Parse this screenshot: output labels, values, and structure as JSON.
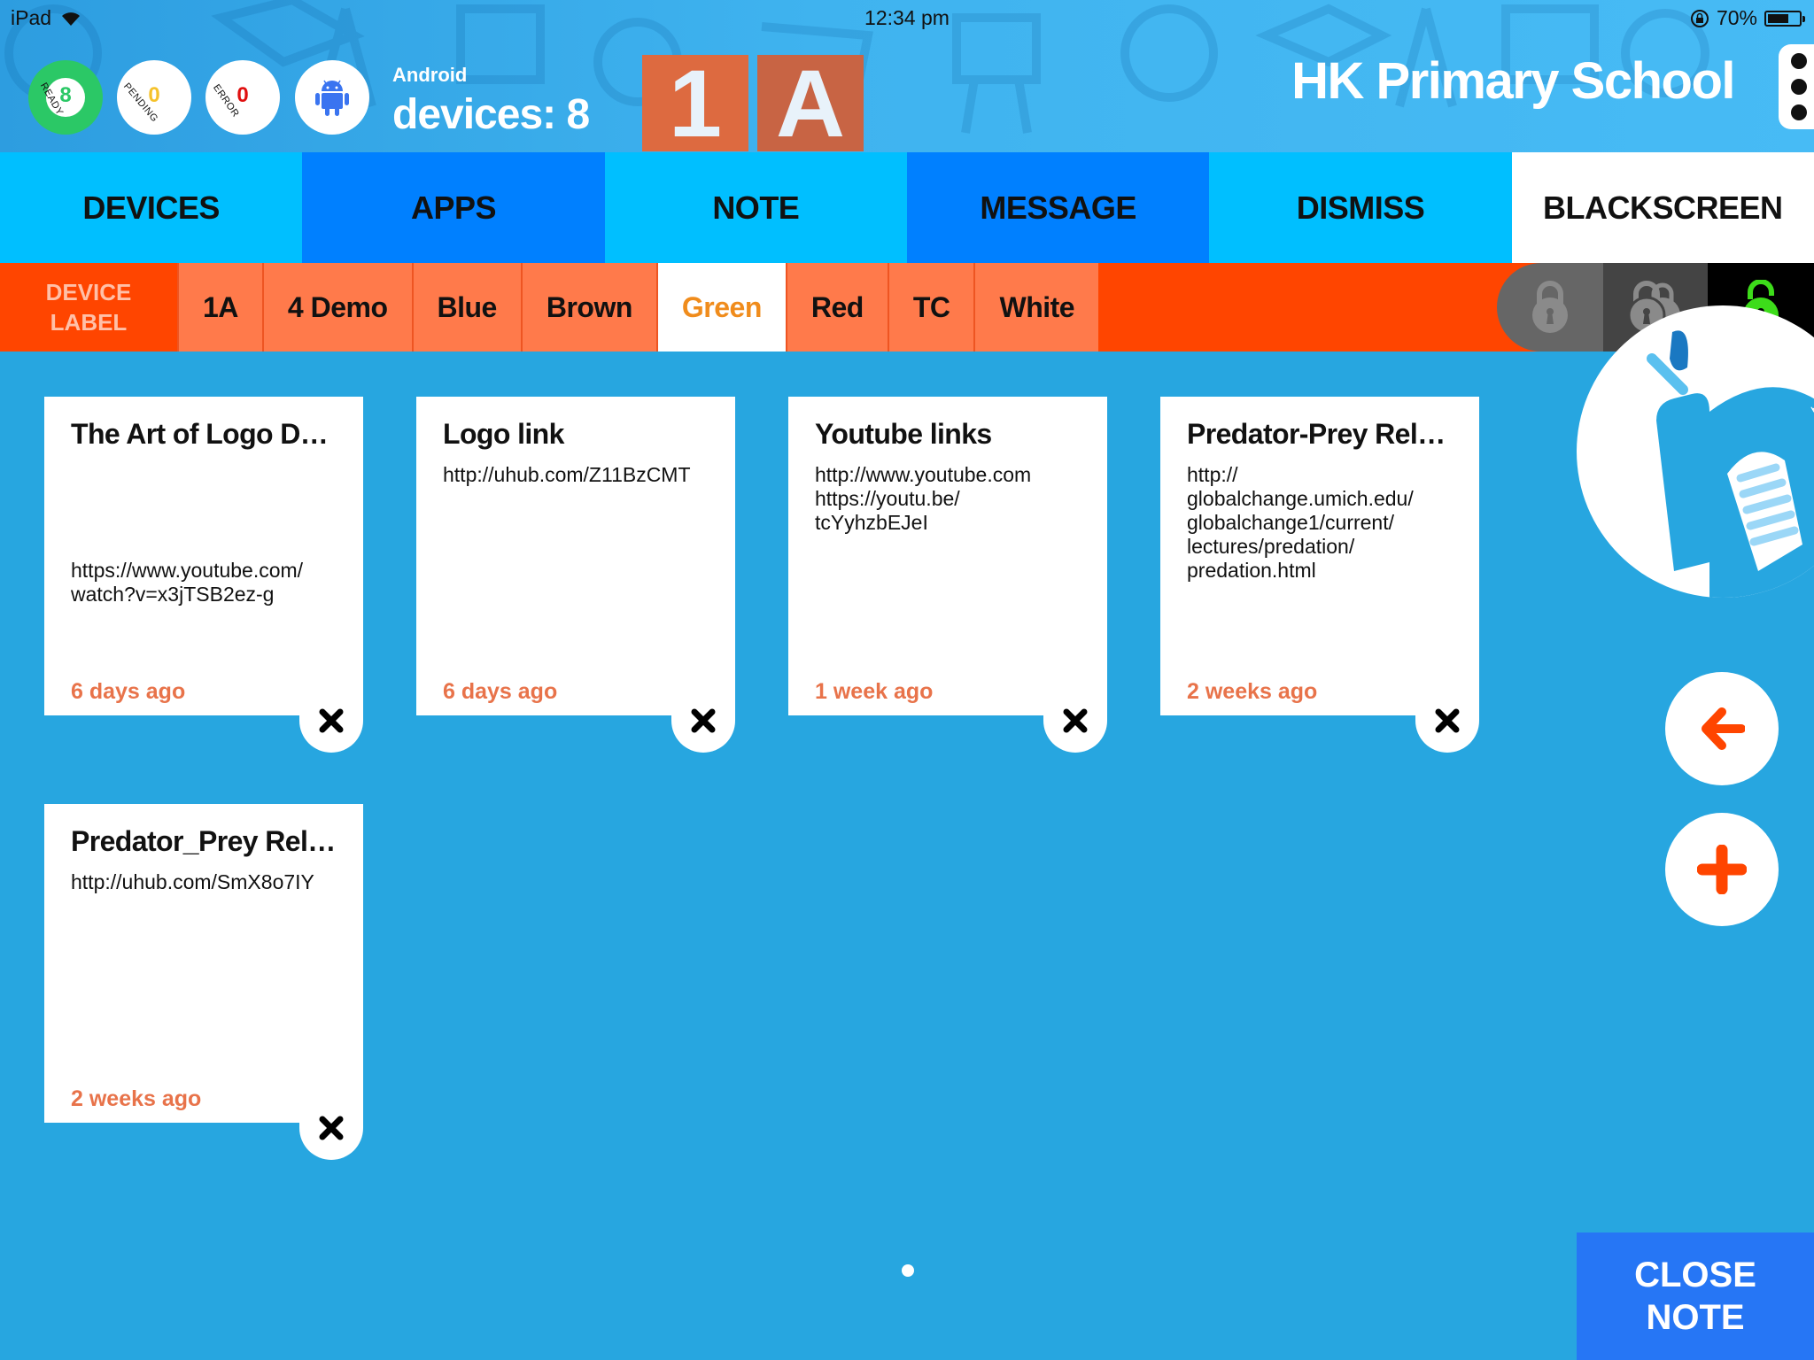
{
  "status_bar": {
    "device": "iPad",
    "time": "12:34 pm",
    "battery_percent": "70%",
    "battery_level": 0.7
  },
  "header": {
    "stats": [
      {
        "label": "READY",
        "value": "8",
        "color": "#2bc866"
      },
      {
        "label": "PENDING",
        "value": "0",
        "color": "#f5c22b"
      },
      {
        "label": "ERROR",
        "value": "0",
        "color": "#e01010"
      }
    ],
    "platform_icon": "android-icon",
    "platform": "Android",
    "devices_label": "devices: 8",
    "class_badge": [
      "1",
      "A"
    ],
    "school_name": "HK Primary School",
    "menu_icon": "more-vertical-icon"
  },
  "tabs": [
    {
      "label": "DEVICES",
      "bg": "#00bfff",
      "active": false
    },
    {
      "label": "APPS",
      "bg": "#0080ff",
      "active": false
    },
    {
      "label": "NOTE",
      "bg": "#00bfff",
      "active": true
    },
    {
      "label": "MESSAGE",
      "bg": "#0080ff",
      "active": false
    },
    {
      "label": "DISMISS",
      "bg": "#00bfff",
      "active": false
    },
    {
      "label": "BLACKSCREEN",
      "bg": "#ffffff",
      "active": false
    }
  ],
  "label_bar": {
    "title_line1": "DEVICE",
    "title_line2": "LABEL",
    "items": [
      "1A",
      "4 Demo",
      "Blue",
      "Brown",
      "Green",
      "Red",
      "TC",
      "White"
    ],
    "selected": "Green",
    "lock_buttons": [
      {
        "name": "lock-all-icon",
        "state": "inactive"
      },
      {
        "name": "lock-multiple-icon",
        "state": "inactive"
      },
      {
        "name": "unlock-icon",
        "state": "active",
        "color": "#3ddc1a"
      }
    ]
  },
  "notes": [
    {
      "title": "The Art of Logo Design",
      "body": "\n\n\n\nhttps://www.youtube.com/\nwatch?v=x3jTSB2ez-g",
      "time": "6 days ago"
    },
    {
      "title": "Logo link",
      "body": "http://uhub.com/Z11BzCMT",
      "time": "6 days ago"
    },
    {
      "title": "Youtube links",
      "body": "http://www.youtube.com\nhttps://youtu.be/\ntcYyhzbEJeI",
      "time": "1 week ago"
    },
    {
      "title": "Predator-Prey Relati…",
      "body": "http://\nglobalchange.umich.edu/\nglobalchange1/current/\nlectures/predation/\npredation.html",
      "time": "2 weeks ago"
    },
    {
      "title": "Predator_Prey Relati…",
      "body": "http://uhub.com/SmX8o7IY",
      "time": "2 weeks ago"
    }
  ],
  "side": {
    "logo_text": "NOTE",
    "back_icon": "arrow-left-icon",
    "add_icon": "plus-icon",
    "accent": "#ff4500"
  },
  "pagination": {
    "current": 1,
    "total": 1
  },
  "close_button": {
    "line1": "CLOSE",
    "line2": "NOTE"
  }
}
